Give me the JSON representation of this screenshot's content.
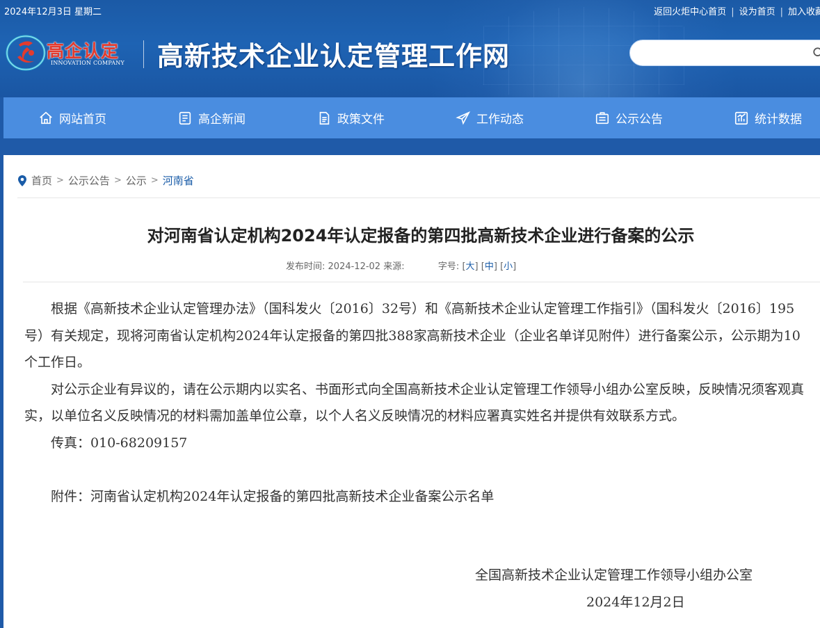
{
  "topbar": {
    "date": "2024年12月3日 星期二",
    "links": [
      "返回火炬中心首页",
      "设为首页",
      "加入收藏"
    ]
  },
  "logo": {
    "cn": "高企认定",
    "en": "INNOVATION COMPANY"
  },
  "site_title": "高新技术企业认定管理工作网",
  "search": {
    "placeholder": ""
  },
  "nav": {
    "items": [
      {
        "label": "网站首页",
        "icon": "home-icon"
      },
      {
        "label": "高企新闻",
        "icon": "news-icon"
      },
      {
        "label": "政策文件",
        "icon": "document-icon"
      },
      {
        "label": "工作动态",
        "icon": "send-icon"
      },
      {
        "label": "公示公告",
        "icon": "notice-icon"
      },
      {
        "label": "统计数据",
        "icon": "chart-icon"
      }
    ]
  },
  "breadcrumb": {
    "items": [
      "首页",
      "公示公告",
      "公示",
      "河南省"
    ]
  },
  "article": {
    "title": "对河南省认定机构2024年认定报备的第四批高新技术企业进行备案的公示",
    "meta": {
      "publish_label": "发布时间:",
      "publish_date": "2024-12-02",
      "source_label": "来源:",
      "fontsize_label": "字号:",
      "sizes": [
        "大",
        "中",
        "小"
      ]
    },
    "paragraphs": [
      "根据《高新技术企业认定管理办法》（国科发火〔2016〕32号）和《高新技术企业认定管理工作指引》（国科发火〔2016〕195号）有关规定，现将河南省认定机构2024年认定报备的第四批388家高新技术企业（企业名单详见附件）进行备案公示，公示期为10个工作日。",
      "对公示企业有异议的，请在公示期内以实名、书面形式向全国高新技术企业认定管理工作领导小组办公室反映，反映情况须客观真实，以单位名义反映情况的材料需加盖单位公章，以个人名义反映情况的材料应署真实姓名并提供有效联系方式。",
      "传真：010-68209157",
      "附件：河南省认定机构2024年认定报备的第四批高新技术企业备案公示名单"
    ],
    "signature": "全国高新技术企业认定管理工作领导小组办公室",
    "sign_date": "2024年12月2日"
  },
  "colors": {
    "header_bg": "#1e63b3",
    "nav_bg": "#4a8de0",
    "link": "#1a5ca8",
    "logo_red": "#e33b2e"
  }
}
